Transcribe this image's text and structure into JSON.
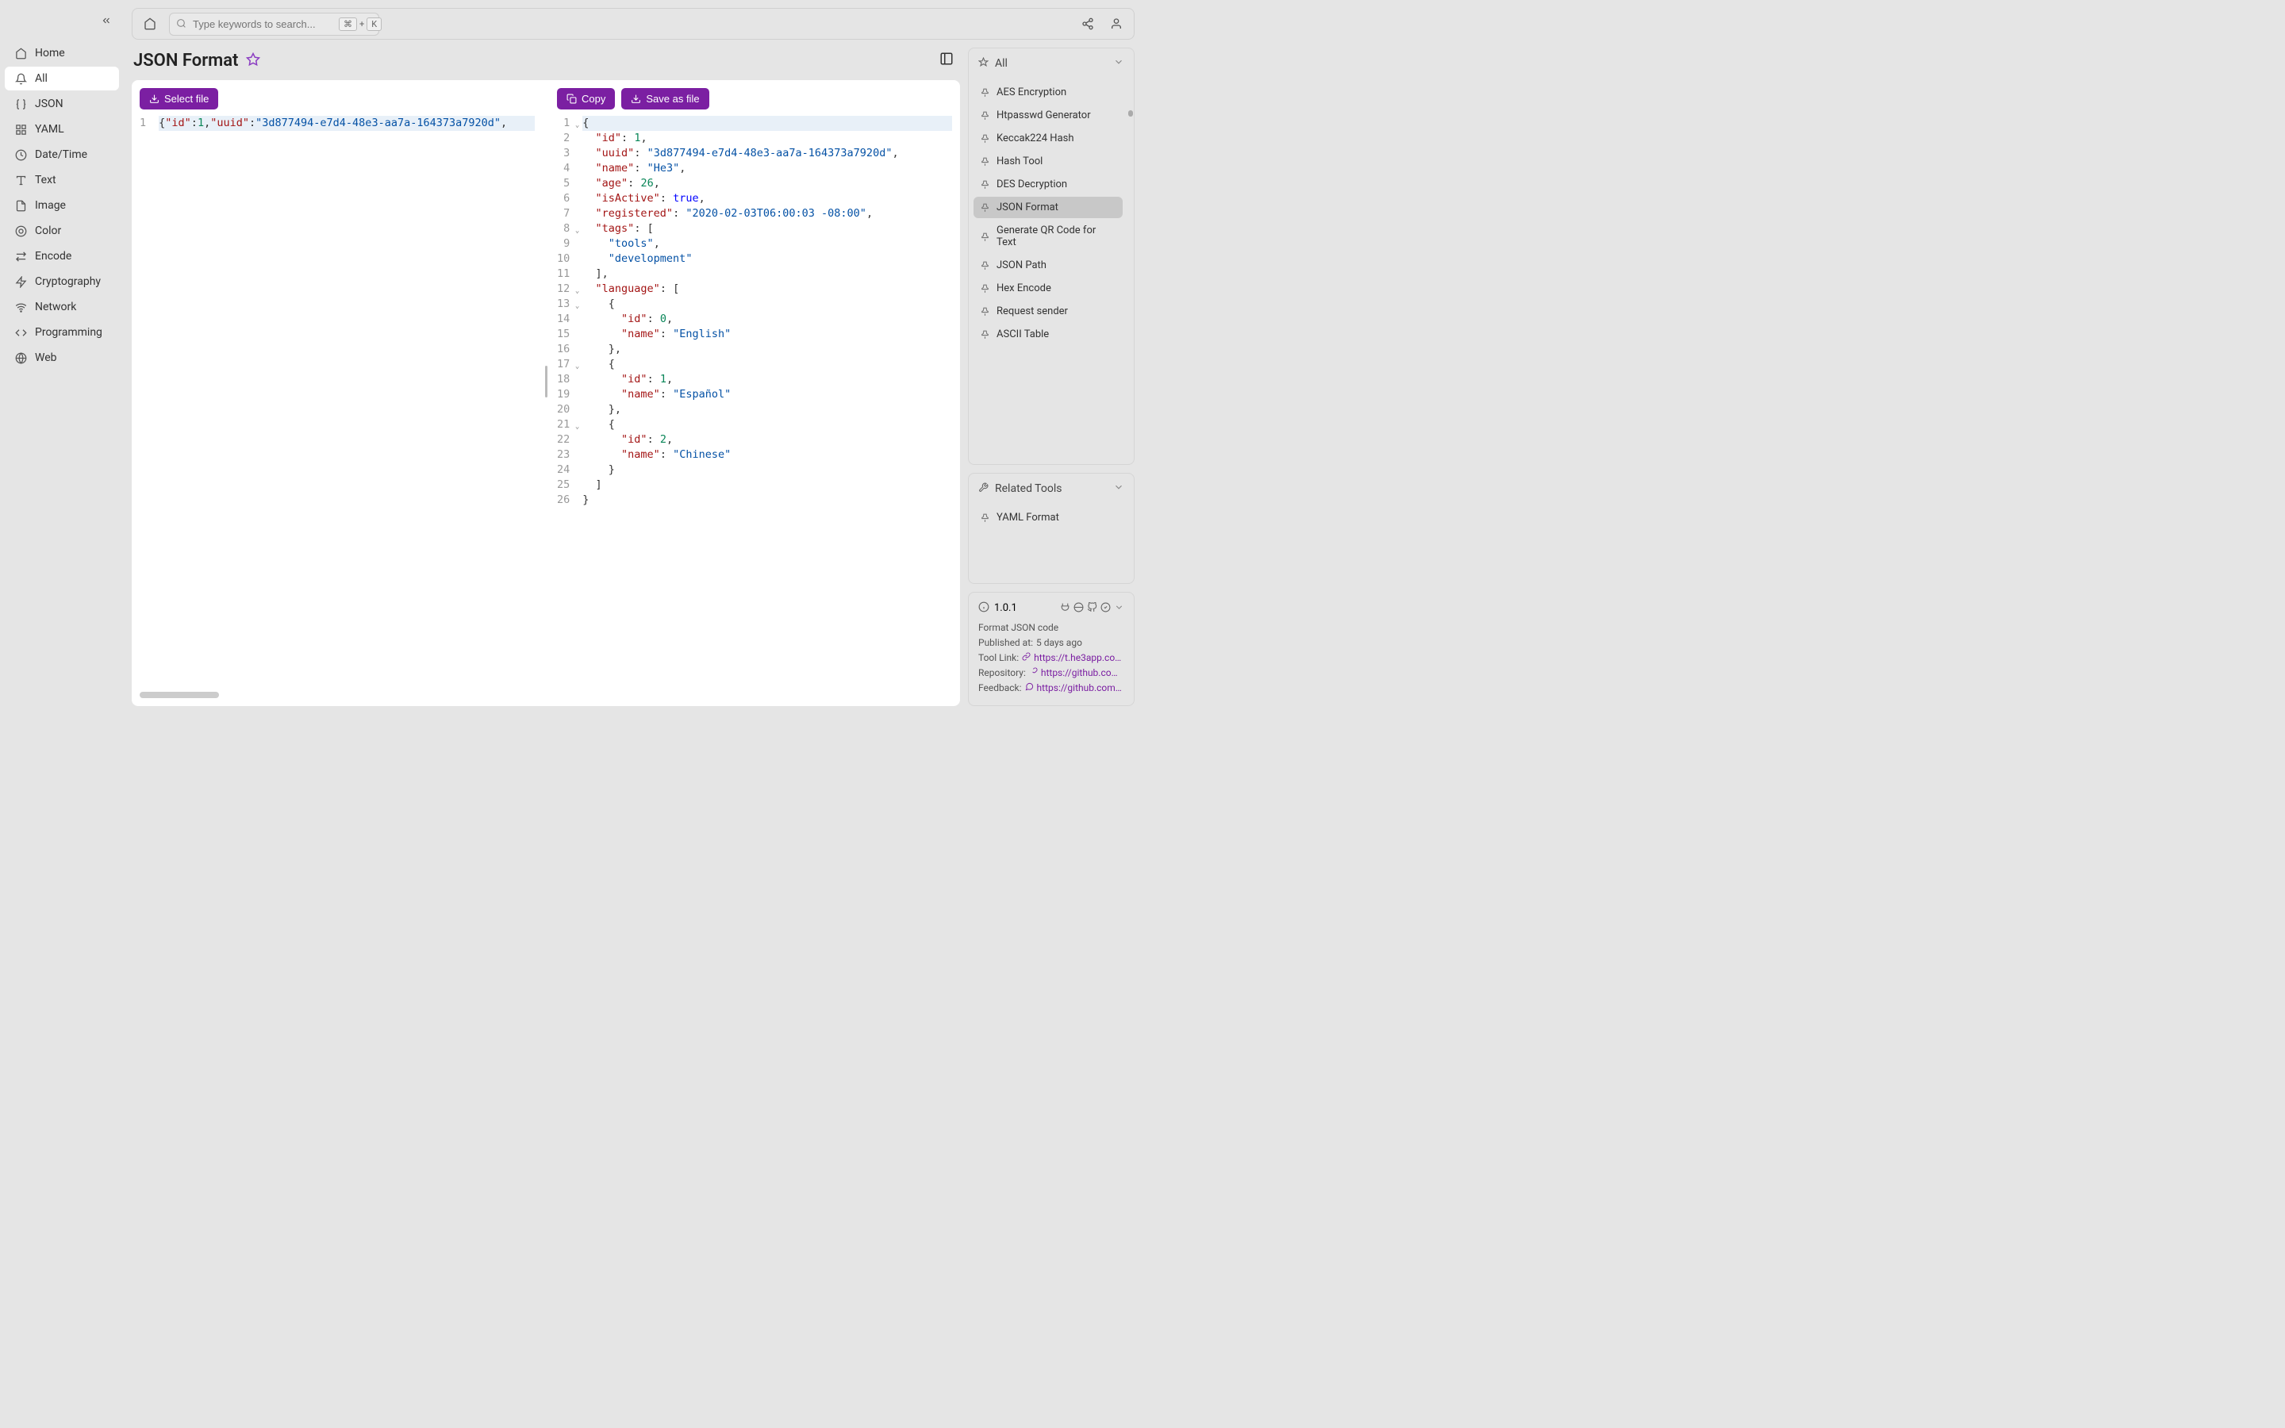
{
  "sidebar": {
    "items": [
      {
        "label": "Home",
        "icon": "home"
      },
      {
        "label": "All",
        "icon": "bell",
        "active": true
      },
      {
        "label": "JSON",
        "icon": "braces"
      },
      {
        "label": "YAML",
        "icon": "grid"
      },
      {
        "label": "Date/Time",
        "icon": "clock"
      },
      {
        "label": "Text",
        "icon": "text"
      },
      {
        "label": "Image",
        "icon": "file"
      },
      {
        "label": "Color",
        "icon": "palette"
      },
      {
        "label": "Encode",
        "icon": "arrows"
      },
      {
        "label": "Cryptography",
        "icon": "bolt"
      },
      {
        "label": "Network",
        "icon": "wifi"
      },
      {
        "label": "Programming",
        "icon": "code"
      },
      {
        "label": "Web",
        "icon": "globe"
      }
    ]
  },
  "search": {
    "placeholder": "Type keywords to search...",
    "kbd1": "⌘",
    "plus": "+",
    "kbd2": "K"
  },
  "page": {
    "title": "JSON Format"
  },
  "buttons": {
    "select_file": "Select file",
    "copy": "Copy",
    "save_as_file": "Save as file"
  },
  "editor_left": {
    "line1_raw": "{\"id\":1,\"uuid\":\"3d877494-e7d4-48e3-aa7a-164373a7920d\","
  },
  "editor_right": {
    "lines": [
      "{",
      "  \"id\": 1,",
      "  \"uuid\": \"3d877494-e7d4-48e3-aa7a-164373a7920d\",",
      "  \"name\": \"He3\",",
      "  \"age\": 26,",
      "  \"isActive\": true,",
      "  \"registered\": \"2020-02-03T06:00:03 -08:00\",",
      "  \"tags\": [",
      "    \"tools\",",
      "    \"development\"",
      "  ],",
      "  \"language\": [",
      "    {",
      "      \"id\": 0,",
      "      \"name\": \"English\"",
      "    },",
      "    {",
      "      \"id\": 1,",
      "      \"name\": \"Español\"",
      "    },",
      "    {",
      "      \"id\": 2,",
      "      \"name\": \"Chinese\"",
      "    }",
      "  ]",
      "}"
    ]
  },
  "right": {
    "all_header": "All",
    "items": [
      "AES Encryption",
      "Htpasswd Generator",
      "Keccak224 Hash",
      "Hash Tool",
      "DES Decryption",
      "JSON Format",
      "Generate QR Code for Text",
      "JSON Path",
      "Hex Encode",
      "Request sender",
      "ASCII Table"
    ],
    "active_index": 5,
    "related_header": "Related Tools",
    "related_items": [
      "YAML Format"
    ]
  },
  "version": {
    "number": "1.0.1",
    "desc": "Format JSON code",
    "published_label": "Published at:",
    "published_value": "5 days ago",
    "tool_link_label": "Tool Link:",
    "tool_link_value": "https://t.he3app.co…",
    "repo_label": "Repository:",
    "repo_value": "https://github.com…",
    "feedback_label": "Feedback:",
    "feedback_value": "https://github.com/…"
  }
}
